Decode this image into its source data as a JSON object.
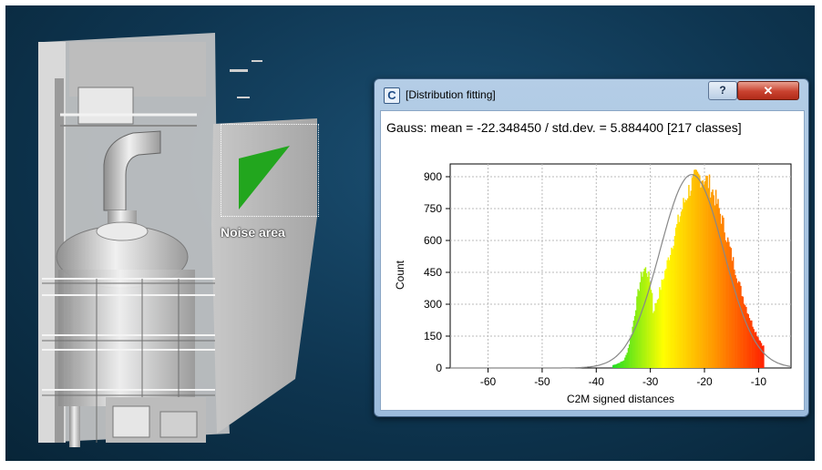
{
  "viewport": {
    "annotation": {
      "label": "Noise area"
    },
    "colors": {
      "background": "#0e3550",
      "noise_area": "#22a61e",
      "cloud": "#d8d8d8"
    }
  },
  "dialog": {
    "title": "[Distribution fitting]",
    "help_label": "?",
    "close_label": "✕",
    "icon": "cloudcompare-logo-icon",
    "summary": "Gauss: mean = -22.348450 / std.dev. = 5.884400 [217 classes]"
  },
  "chart_data": {
    "type": "bar",
    "xlabel": "C2M signed distances",
    "ylabel": "Count",
    "xlim": [
      -67,
      -4
    ],
    "ylim": [
      0,
      960
    ],
    "xticks": [
      -60,
      -50,
      -40,
      -30,
      -20,
      -10
    ],
    "yticks": [
      0,
      150,
      300,
      450,
      600,
      750,
      900
    ],
    "grid": true,
    "histogram": {
      "bin_start": -37.0,
      "bin_end": -9.0,
      "classes": 217,
      "color_scale": [
        "#22dd22",
        "#ffff00",
        "#ff9900",
        "#ff2200"
      ]
    },
    "fit": {
      "kind": "gauss",
      "mean": -22.34845,
      "std": 5.8844,
      "peak": 910,
      "color": "#888888"
    }
  }
}
